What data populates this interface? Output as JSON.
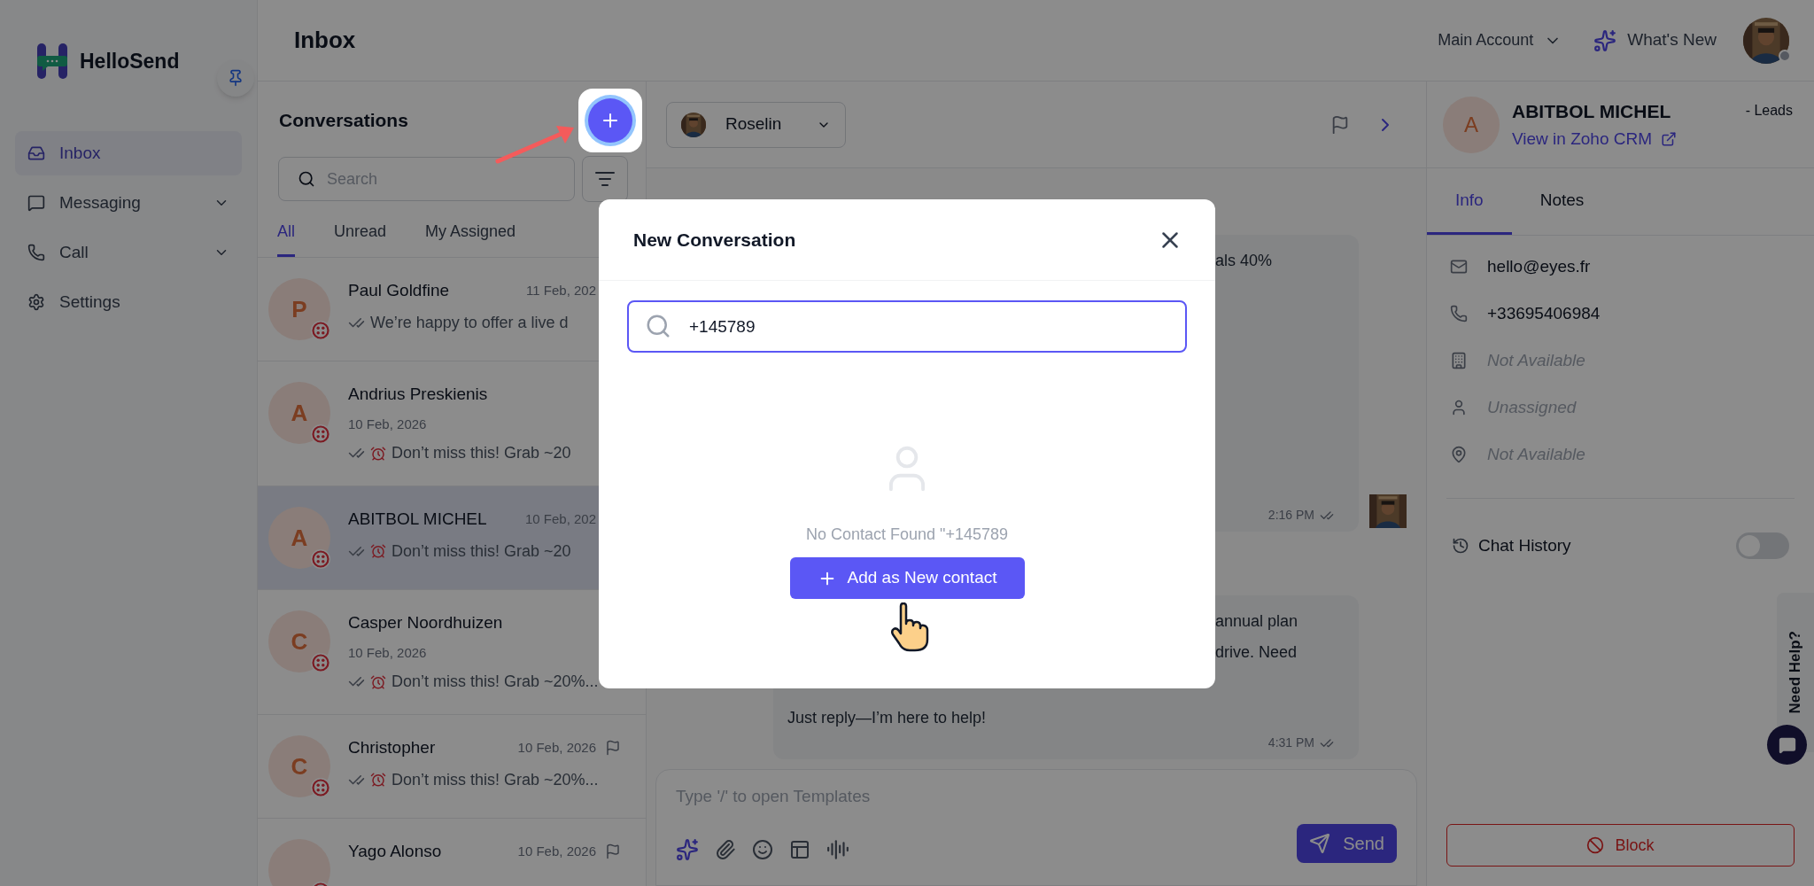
{
  "app": {
    "brand": "HelloSend",
    "page_title": "Inbox"
  },
  "nav": [
    {
      "label": "Inbox",
      "selected": true,
      "expandable": false
    },
    {
      "label": "Messaging",
      "selected": false,
      "expandable": true
    },
    {
      "label": "Call",
      "selected": false,
      "expandable": true
    },
    {
      "label": "Settings",
      "selected": false,
      "expandable": false
    }
  ],
  "topbar": {
    "account": "Main Account",
    "whats_new": "What's New"
  },
  "conversations": {
    "title": "Conversations",
    "search_placeholder": "Search",
    "tabs": [
      {
        "label": "All",
        "selected": true
      },
      {
        "label": "Unread",
        "selected": false
      },
      {
        "label": "My Assigned",
        "selected": false
      }
    ],
    "items": [
      {
        "name": "Paul Goldfine",
        "letter": "P",
        "date": "11 Feb, 202",
        "date_below": false,
        "preview": "We’re happy to offer a live d",
        "alarm": false,
        "flagged": false,
        "selected": false
      },
      {
        "name": "Andrius Preskienis",
        "letter": "A",
        "date": "10 Feb, 2026",
        "date_below": true,
        "preview": "Don’t miss this! Grab ~20",
        "alarm": true,
        "flagged": false,
        "selected": false
      },
      {
        "name": "ABITBOL MICHEL",
        "letter": "A",
        "date": "10 Feb, 202",
        "date_below": false,
        "preview": "Don’t miss this! Grab ~20",
        "alarm": true,
        "flagged": false,
        "selected": true
      },
      {
        "name": "Casper Noordhuizen",
        "letter": "C",
        "date": "10 Feb, 2026",
        "date_below": true,
        "preview": "Don’t miss this! Grab ~20%...",
        "alarm": true,
        "flagged": false,
        "selected": false
      },
      {
        "name": "Christopher",
        "letter": "C",
        "date": "10 Feb, 2026",
        "date_below": false,
        "preview": "Don’t miss this! Grab ~20%...",
        "alarm": true,
        "flagged": true,
        "selected": false
      },
      {
        "name": "Yago Alonso",
        "date": "10 Feb, 2026",
        "date_below": false,
        "alarm": false,
        "flagged": true,
        "selected": false
      }
    ]
  },
  "chat": {
    "agent": "Roselin",
    "messages": [
      {
        "fragments": [
          "als 40%"
        ],
        "time": "2:16 PM",
        "avatar": true
      },
      {
        "fragments": [
          "annual plan",
          "drive. Need"
        ],
        "text": "Just reply—I’m here to help!",
        "time": "4:31 PM",
        "avatar": false
      }
    ]
  },
  "composer": {
    "placeholder": "Type '/' to open Templates",
    "send": "Send"
  },
  "contact": {
    "letter": "A",
    "name": "ABITBOL MICHEL",
    "module": "- Leads",
    "crm_link": "View in Zoho CRM",
    "tabs": [
      {
        "label": "Info",
        "selected": true
      },
      {
        "label": "Notes",
        "selected": false
      }
    ],
    "fields": [
      {
        "value": "hello@eyes.fr",
        "missing": false
      },
      {
        "value": "+33695406984",
        "missing": false
      },
      {
        "value": "Not Available",
        "missing": true
      },
      {
        "value": "Unassigned",
        "missing": true
      },
      {
        "value": "Not Available",
        "missing": true
      }
    ],
    "chat_history": {
      "label": "Chat History",
      "on": false
    },
    "block": "Block"
  },
  "help": {
    "label": "Need Help?"
  },
  "modal": {
    "title": "New Conversation",
    "query": "+145789",
    "empty_text": "No Contact Found \"+145789",
    "add_button": "Add as New contact"
  }
}
